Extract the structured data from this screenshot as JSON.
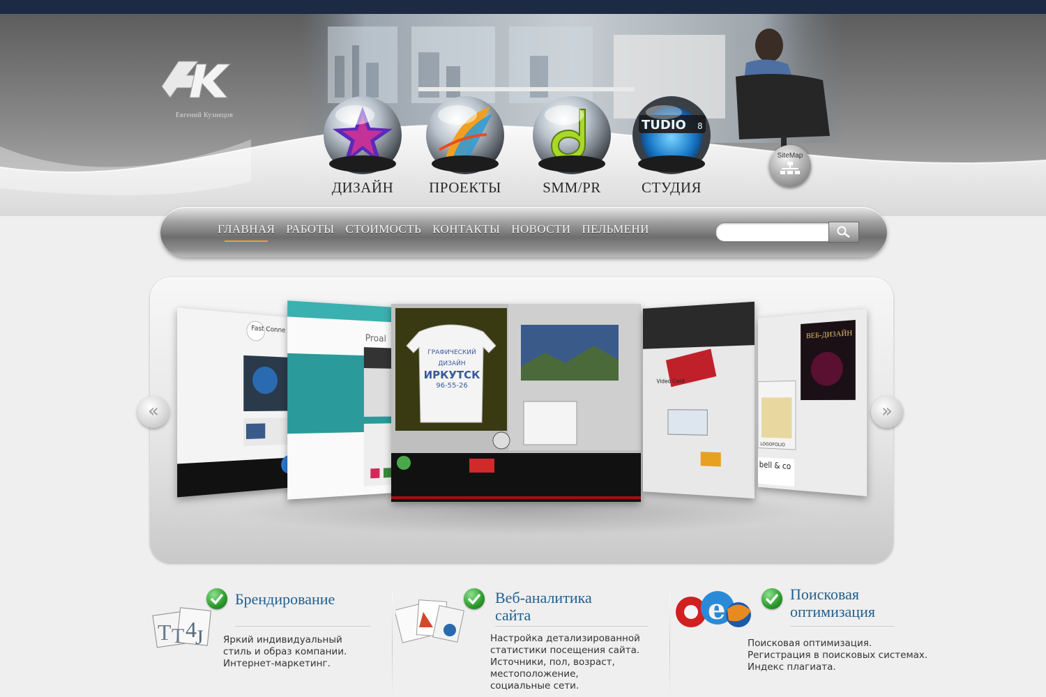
{
  "logo": {
    "initials": "EK",
    "subtitle": "Евгений Кузнецов"
  },
  "main_menu": [
    {
      "label": "ДИЗАЙН",
      "icon": "star-orb-icon"
    },
    {
      "label": "ПРОЕКТЫ",
      "icon": "feather-orb-icon"
    },
    {
      "label": "SMM/PR",
      "icon": "dreamweaver-orb-icon"
    },
    {
      "label": "СТУДИЯ",
      "icon": "studio-orb-icon"
    }
  ],
  "sitemap": {
    "label": "SiteMap"
  },
  "nav": {
    "links": [
      "ГЛАВНАЯ",
      "РАБОТЫ",
      "СТОИМОСТЬ",
      "КОНТАКТЫ",
      "НОВОСТИ",
      "ПЕЛЬМЕНИ"
    ],
    "active": "ГЛАВНАЯ",
    "search_placeholder": ""
  },
  "carousel": {
    "prev_label": "«",
    "next_label": "»",
    "slides": [
      {
        "caption": "Fast Conne"
      },
      {
        "caption": "Proal"
      },
      {
        "shirt_lines": [
          "ГРАФИЧЕСКИЙ",
          "ДИЗАЙН",
          "ИРКУТСК",
          "96-55-26"
        ]
      },
      {
        "caption": "Video Card"
      },
      {
        "caption_top": "ВЕБ-ДИЗАЙН",
        "caption_bottom": "bell & co",
        "logo": "LOGOFOLIO"
      }
    ]
  },
  "features": [
    {
      "title_lines": [
        "Брендирование"
      ],
      "text_lines": [
        "Яркий индивидуальный",
        "стиль  и образ компании.",
        "Интернет-маркетинг."
      ]
    },
    {
      "title_lines": [
        "Веб-аналитика",
        "сайта"
      ],
      "text_lines": [
        "Настройка детализированной",
        "статистики посещения сайта.",
        "Источники, пол, возраст,",
        "местоположение,",
        "социальные сети."
      ]
    },
    {
      "title_lines": [
        "Поисковая",
        "оптимизация"
      ],
      "text_lines": [
        "Поисковая оптимизация.",
        "Регистрация в поисковых системах.",
        "Индекс плагиата."
      ]
    }
  ],
  "colors": {
    "accent_title": "#1f5f8f",
    "topbar": "#1c2a44",
    "check_green": "#2a9a2a",
    "nav_active_underline": "#e8a040"
  }
}
